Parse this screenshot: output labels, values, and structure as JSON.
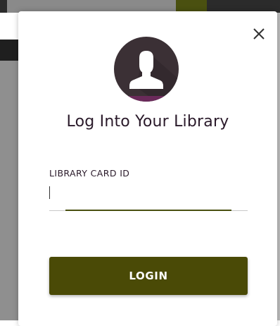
{
  "modal": {
    "title": "Log Into Your Library",
    "field_label": "LIBRARY CARD ID",
    "input_value": "",
    "login_label": "LOGIN",
    "close_icon": "close-icon",
    "avatar_icon": "user-avatar-icon"
  },
  "colors": {
    "accent": "#4a4a06",
    "avatar_bg": "#3b3035",
    "title_text": "#2a1a2a"
  }
}
